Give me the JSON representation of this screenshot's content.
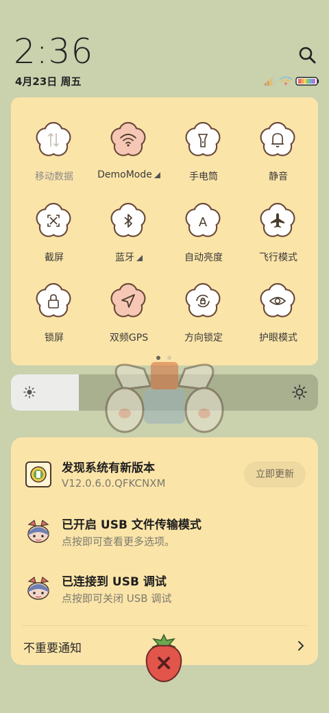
{
  "status": {
    "time": "2:36",
    "date": "4月23日 周五"
  },
  "quick_settings": {
    "tiles": [
      {
        "label": "移动数据",
        "icon": "mobile-data-icon",
        "active": false
      },
      {
        "label": "DemoMode",
        "icon": "wifi-icon",
        "active": true,
        "has_more": true
      },
      {
        "label": "手电筒",
        "icon": "flashlight-icon",
        "active": false
      },
      {
        "label": "静音",
        "icon": "bell-icon",
        "active": false
      },
      {
        "label": "截屏",
        "icon": "screenshot-icon",
        "active": false
      },
      {
        "label": "蓝牙",
        "icon": "bluetooth-icon",
        "active": false,
        "has_more": true
      },
      {
        "label": "自动亮度",
        "icon": "auto-brightness-icon",
        "active": false
      },
      {
        "label": "飞行模式",
        "icon": "airplane-icon",
        "active": false
      },
      {
        "label": "锁屏",
        "icon": "lock-icon",
        "active": false
      },
      {
        "label": "双频GPS",
        "icon": "location-arrow-icon",
        "active": true
      },
      {
        "label": "方向锁定",
        "icon": "rotation-lock-icon",
        "active": false
      },
      {
        "label": "护眼模式",
        "icon": "eye-icon",
        "active": false
      }
    ],
    "page_count": 2,
    "current_page": 1
  },
  "brightness": {
    "level": 0.22
  },
  "notifications": [
    {
      "title": "发现系统有新版本",
      "subtitle": "V12.0.6.0.QFKCNXM",
      "icon": "system-update-icon",
      "action": "立即更新"
    },
    {
      "title": "已开启 USB 文件传输模式",
      "subtitle": "点按即可查看更多选项。",
      "icon": "usb-character-icon"
    },
    {
      "title": "已连接到 USB 调试",
      "subtitle": "点按即可关闭 USB 调试",
      "icon": "usb-character-icon"
    }
  ],
  "unimportant": {
    "label": "不重要通知"
  },
  "colors": {
    "background": "#c9d1ad",
    "panel": "#fbe4a8",
    "flower_active": "#f6c7b4",
    "flower_inactive": "#ffffff",
    "outline": "#6b4a3a",
    "strawberry": "#e2554a"
  }
}
